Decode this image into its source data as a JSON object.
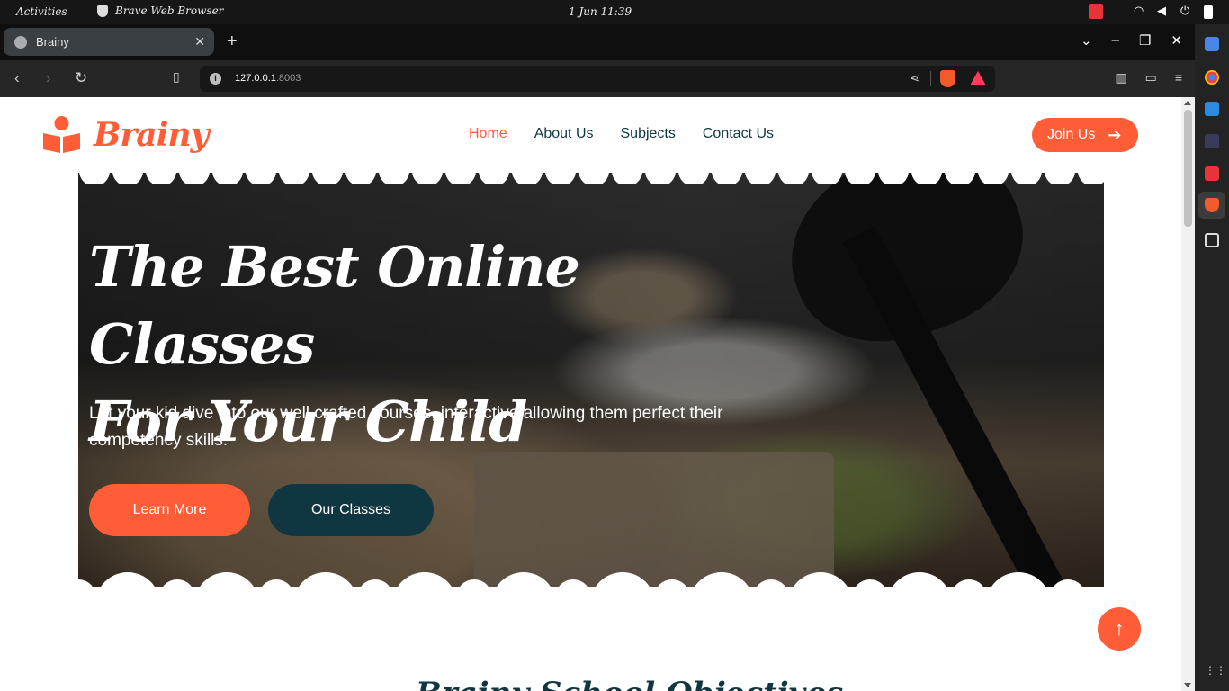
{
  "system": {
    "activities": "Activities",
    "app_name": "Brave Web Browser",
    "clock": "1 Jun  11:39"
  },
  "browser": {
    "tab_title": "Brainy",
    "tab_close": "✕",
    "new_tab": "+",
    "url_host": "127.0.0.1",
    "url_port": ":8003",
    "window_controls": [
      "⌄",
      "–",
      "❐",
      "✕"
    ]
  },
  "site": {
    "brand": "Brainy",
    "nav": [
      {
        "label": "Home",
        "active": true
      },
      {
        "label": "About Us",
        "active": false
      },
      {
        "label": "Subjects",
        "active": false
      },
      {
        "label": "Contact Us",
        "active": false
      }
    ],
    "join_label": "Join Us",
    "hero": {
      "title_line1": "The Best Online Classes",
      "title_line2": "For Your Child",
      "subtitle": "Let your kid dive into our well crafted courses, interactive allowing them perfect their competency skills.",
      "primary_button": "Learn More",
      "secondary_button": "Our Classes"
    },
    "section_title_partial": "Brainy School Objectives"
  },
  "colors": {
    "accent": "#fe5d37",
    "dark": "#103741"
  }
}
